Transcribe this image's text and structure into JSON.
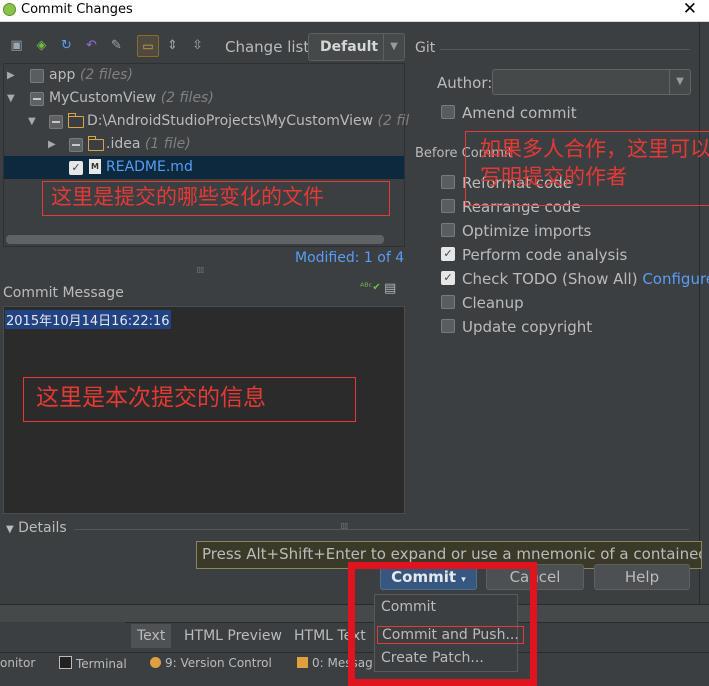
{
  "window": {
    "title": "Commit Changes",
    "close_glyph": "✕"
  },
  "toolbar": {
    "changelist_label": "Change list:",
    "changelist_value": "Default"
  },
  "tree": {
    "rows": [
      {
        "name": "app",
        "count": "(2 files)"
      },
      {
        "name": "MyCustomView",
        "count": "(2 files)"
      },
      {
        "name": "D:\\AndroidStudioProjects\\MyCustomView",
        "count": "(2 fil"
      },
      {
        "name": ".idea",
        "count": "(1 file)"
      },
      {
        "name": "README.md",
        "count": ""
      }
    ],
    "modified": "Modified: 1 of 4"
  },
  "commit_message": {
    "label": "Commit Message",
    "text": "2015年10月14日16:22:16"
  },
  "git": {
    "section_label": "Git",
    "author_label": "Author:",
    "amend_label": "Amend commit",
    "before_commit_label": "Before Commit",
    "options": [
      {
        "label": "Reformat code",
        "checked": false
      },
      {
        "label": "Rearrange code",
        "checked": false
      },
      {
        "label": "Optimize imports",
        "checked": false
      },
      {
        "label": "Perform code analysis",
        "checked": true
      },
      {
        "label": "Check TODO (Show All)",
        "checked": true,
        "link": "Configure"
      },
      {
        "label": "Cleanup",
        "checked": false
      },
      {
        "label": "Update copyright",
        "checked": false
      }
    ]
  },
  "annotations": {
    "files": "这里是提交的哪些变化的文件",
    "author": "如果多人合作，这里可以写明提交的作者",
    "message": "这里是本次提交的信息"
  },
  "details_label": "Details",
  "tooltip": "Press Alt+Shift+Enter to expand or use a mnemonic of a contained action",
  "buttons": {
    "commit": "Commit",
    "cancel": "Cancel",
    "help": "Help"
  },
  "dropdown": [
    "Commit",
    "Commit and Push...",
    "Create Patch..."
  ],
  "bottom_tabs": [
    "Text",
    "HTML Preview",
    "HTML Text"
  ],
  "statusbar": [
    "onitor",
    "Terminal",
    "9: Version Control",
    "0: Messag"
  ],
  "colors": {
    "background": "#3c3f41",
    "link": "#589df6",
    "annotation": "#e53935",
    "primary_button": "#365880"
  }
}
